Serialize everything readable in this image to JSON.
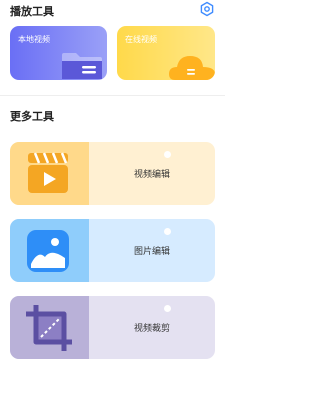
{
  "play_tools": {
    "title": "播放工具",
    "local_video": "本地视频",
    "online_video": "在线视频"
  },
  "more_tools": {
    "title": "更多工具",
    "items": [
      {
        "label": "视频编辑",
        "icon": "video-clapper-icon"
      },
      {
        "label": "图片编辑",
        "icon": "image-icon"
      },
      {
        "label": "视频裁剪",
        "icon": "crop-icon"
      }
    ]
  },
  "colors": {
    "local_card": "#6a6ff5",
    "online_card": "#ffd94a",
    "video_edit_bg": "#fff0d2",
    "image_edit_bg": "#d6ebff",
    "video_crop_bg": "#e4e1f1"
  }
}
